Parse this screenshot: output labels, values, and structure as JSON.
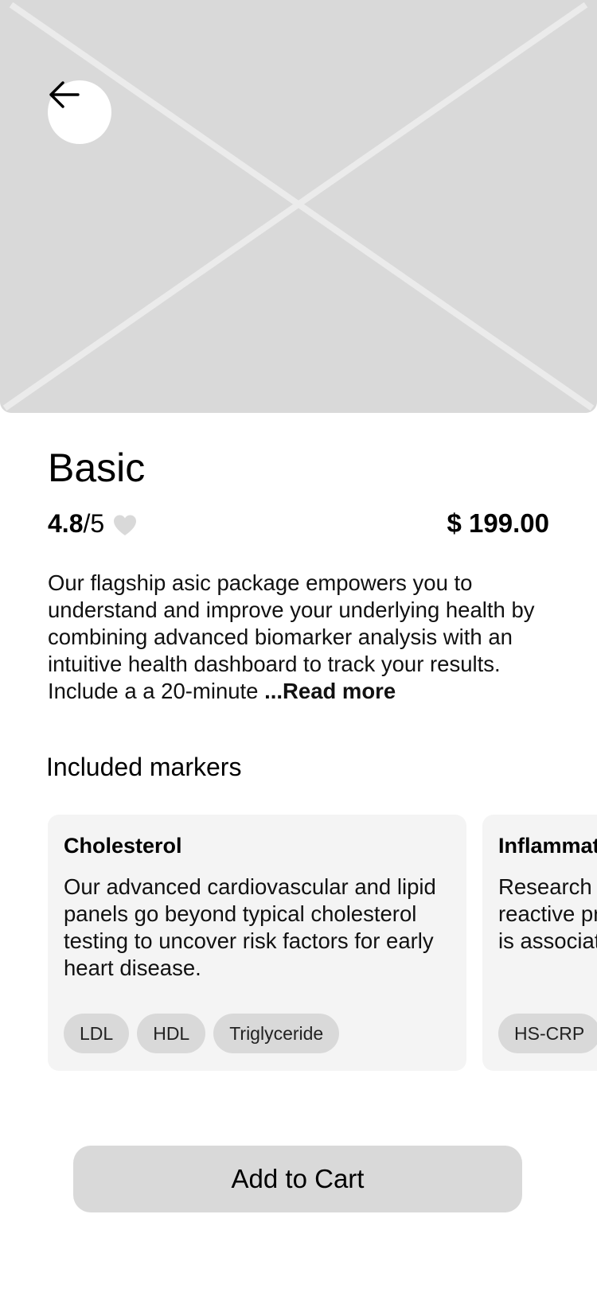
{
  "hero": {
    "image": "placeholder-image",
    "back_icon": "arrow-left-icon"
  },
  "product": {
    "name": "Basic",
    "rating_value": "4.8",
    "rating_max": "/5",
    "favorite_icon": "heart-icon",
    "price": "$ 199.00",
    "description": "Our flagship asic package empowers you to understand and improve your underlying health by combining advanced biomarker analysis with an intuitive health dashboard to track your results. Include a a 20-minute",
    "read_more": "...Read more"
  },
  "markers": {
    "section_title": "Included markers",
    "cards": [
      {
        "title": "Cholesterol",
        "text": "Our advanced cardiovascular and lipid panels go beyond typical cholesterol testing to uncover risk factors for early heart disease.",
        "tags": [
          "LDL",
          "HDL",
          "Triglyceride"
        ]
      },
      {
        "title": "Inflammation",
        "text": "Research shows high-sensitivity C-reactive protein (hs-CRP) inflammation is associated",
        "tags": [
          "HS-CRP"
        ]
      }
    ]
  },
  "actions": {
    "add_to_cart": "Add to Cart"
  },
  "colors": {
    "placeholder": "#d9d9d9",
    "card_background": "#f4f4f4",
    "chip_background": "#d9d9d9",
    "button_background": "#d9d9d9"
  }
}
